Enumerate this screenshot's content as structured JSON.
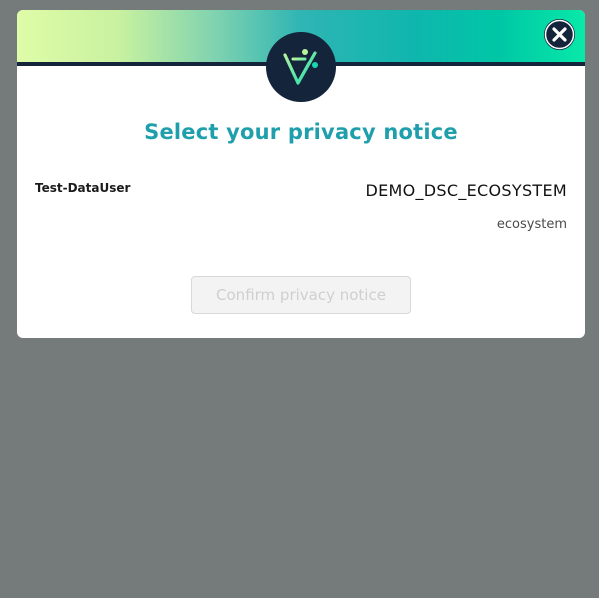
{
  "modal": {
    "title": "Select your privacy notice",
    "user": "Test-DataUser",
    "notice_name": "DEMO_DSC_ECOSYSTEM",
    "notice_type": "ecosystem",
    "confirm_label": "Confirm privacy notice",
    "confirm_enabled": false
  },
  "icons": {
    "logo": "visions-logo-icon",
    "close": "close-icon"
  },
  "colors": {
    "accent": "#1f9fac",
    "header_dark": "#13243b",
    "overlay": "#757a7a"
  }
}
